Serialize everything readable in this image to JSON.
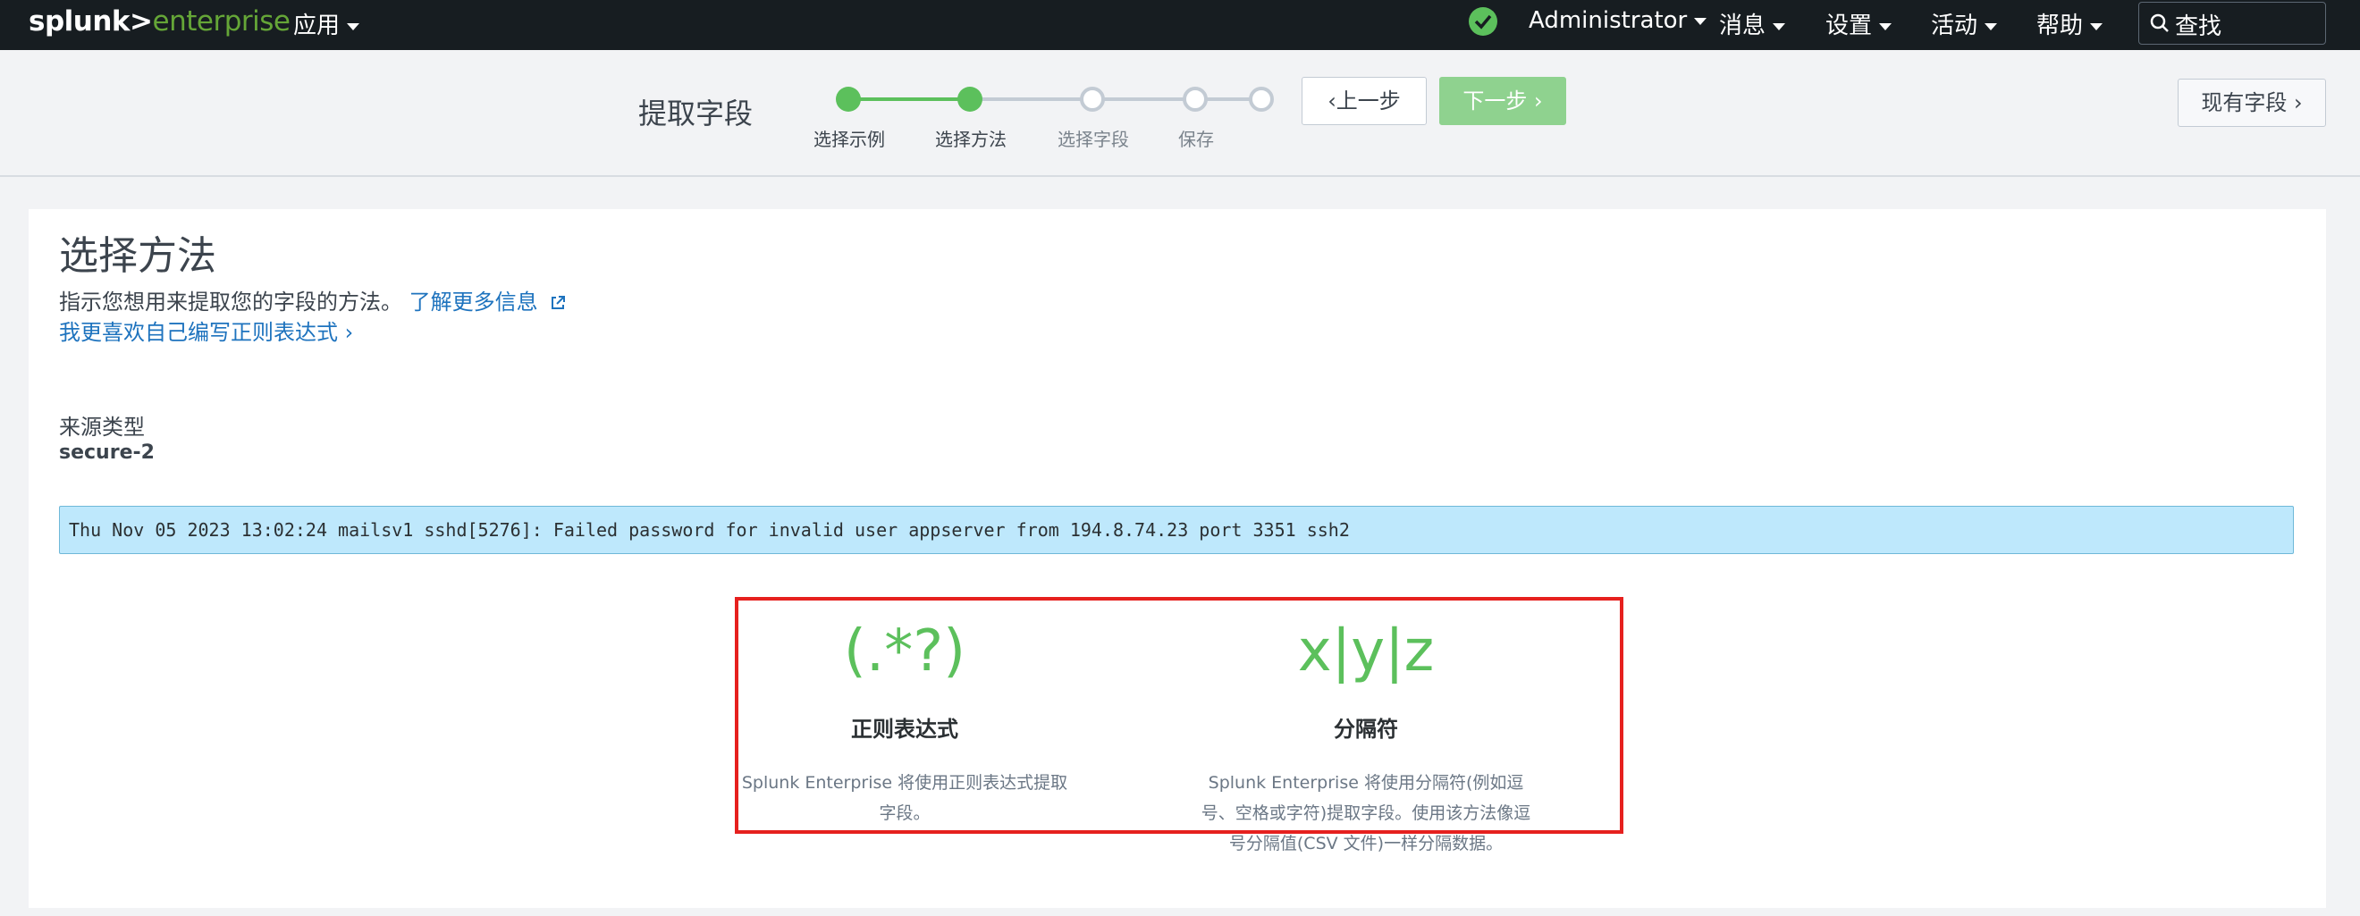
{
  "navbar": {
    "logo_brand": "splunk>",
    "logo_product": "enterprise",
    "apps": "应用",
    "user": "Administrator",
    "messages": "消息",
    "settings": "设置",
    "activity": "活动",
    "help": "帮助",
    "search_placeholder": "查找",
    "status_color": "#5cc05c"
  },
  "wizard": {
    "title": "提取字段",
    "steps": [
      {
        "label": "选择示例",
        "state": "done"
      },
      {
        "label": "选择方法",
        "state": "done"
      },
      {
        "label": "选择字段",
        "state": "todo"
      },
      {
        "label": "保存",
        "state": "todo"
      }
    ],
    "prev_label": "上一步",
    "next_label": "下一步",
    "existing_fields_label": "现有字段"
  },
  "main": {
    "heading": "选择方法",
    "description": "指示您想用来提取您的字段的方法。",
    "learn_more": "了解更多信息",
    "write_regex_link": "我更喜欢自己编写正则表达式",
    "source_type_label": "来源类型",
    "source_type_value": "secure-2",
    "sample_event": "Thu Nov 05 2023 13:02:24 mailsv1 sshd[5276]: Failed password for invalid user appserver from 194.8.74.23 port 3351 ssh2",
    "methods": [
      {
        "icon": "(.*?)",
        "title": "正则表达式",
        "description": "Splunk Enterprise 将使用正则表达式提取字段。"
      },
      {
        "icon": "x|y|z",
        "title": "分隔符",
        "description": "Splunk Enterprise 将使用分隔符(例如逗号、空格或字符)提取字段。使用该方法像逗号分隔值(CSV 文件)一样分隔数据。"
      }
    ]
  },
  "colors": {
    "accent_green": "#5cc05c",
    "link_blue": "#1e73be",
    "highlight_red": "#e6201e",
    "event_bg": "#bee8fc"
  }
}
